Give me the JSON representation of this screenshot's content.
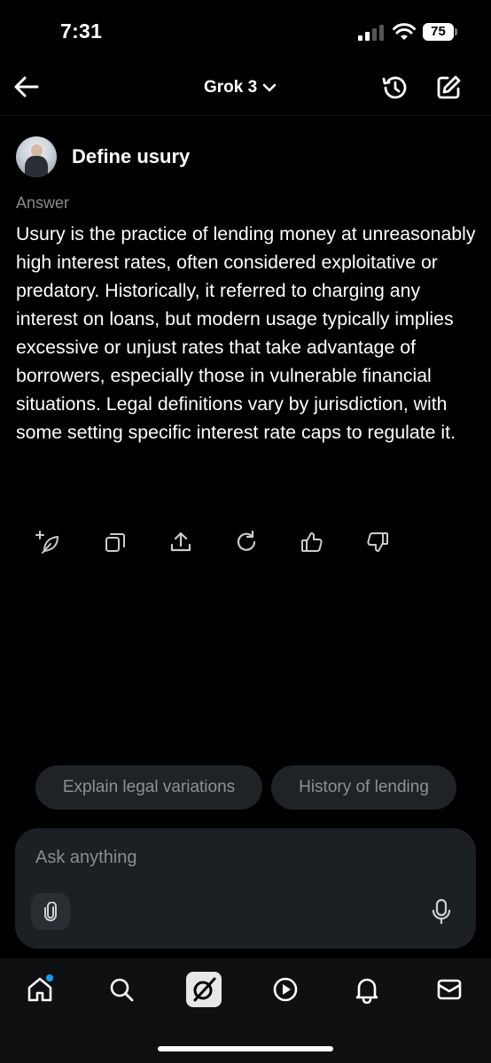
{
  "status_bar": {
    "time": "7:31",
    "battery": "75"
  },
  "header": {
    "model_label": "Grok 3"
  },
  "conversation": {
    "question": "Define usury",
    "answer_label": "Answer",
    "answer": "Usury is the practice of lending money at unreasonably high interest rates, often considered exploitative or predatory. Historically, it referred to charging any interest on loans, but modern usage typically implies excessive or unjust rates that take advantage of borrowers, especially those in vulnerable financial situations. Legal definitions vary by jurisdiction, with some setting specific interest rate caps to regulate it."
  },
  "actions": [
    "regenerate-sparkle-icon",
    "copy-icon",
    "share-icon",
    "refresh-icon",
    "thumbs-up-icon",
    "thumbs-down-icon"
  ],
  "suggestions": [
    "Explain legal variations",
    "History of lending"
  ],
  "composer": {
    "placeholder": "Ask anything"
  },
  "tabbar": [
    "home-icon",
    "search-icon",
    "grok-icon",
    "play-icon",
    "bell-icon",
    "mail-icon"
  ],
  "colors": {
    "background": "#000000",
    "chip": "#1f2226",
    "input": "#1c1f23",
    "badge": "#1d9bf0"
  }
}
